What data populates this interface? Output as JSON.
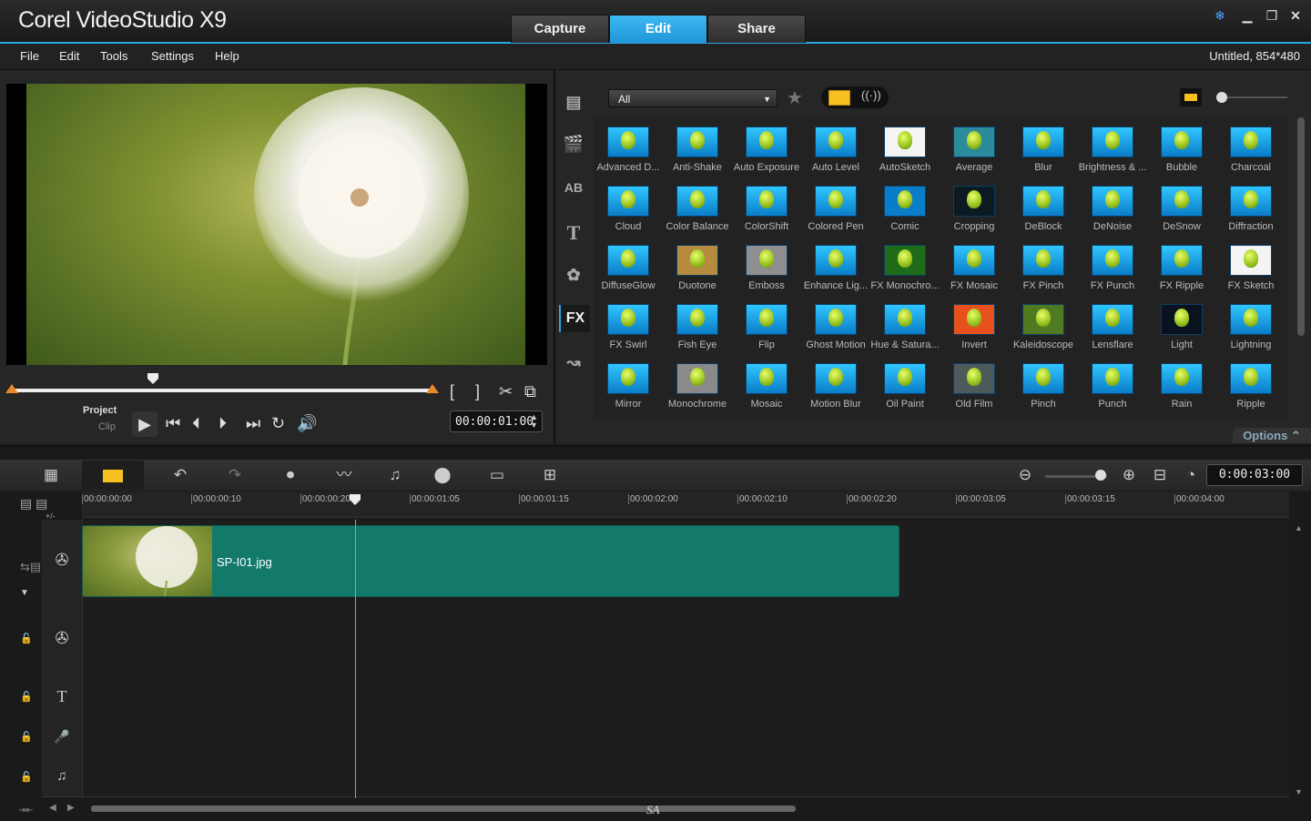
{
  "app": {
    "title": "Corel VideoStudio X9",
    "tabs": [
      "Capture",
      "Edit",
      "Share"
    ],
    "active_tab": "Edit",
    "project_info": "Untitled, 854*480"
  },
  "menu": [
    "File",
    "Edit",
    "Tools",
    "Settings",
    "Help"
  ],
  "preview": {
    "mode_project": "Project",
    "mode_clip": "Clip",
    "timecode": "00:00:01:00",
    "bracket_in": "[",
    "bracket_out": "]"
  },
  "library": {
    "filter": "All",
    "options_label": "Options",
    "active_category": "FX",
    "side_icons": [
      "media-icon",
      "instant-project-icon",
      "transition-icon",
      "title-icon",
      "graphic-icon",
      "fx-icon",
      "path-icon"
    ],
    "filters": [
      "Advanced D...",
      "Anti-Shake",
      "Auto Exposure",
      "Auto Level",
      "AutoSketch",
      "Average",
      "Blur",
      "Brightness & ...",
      "Bubble",
      "Charcoal",
      "Cloud",
      "Color Balance",
      "ColorShift",
      "Colored Pen",
      "Comic",
      "Cropping",
      "DeBlock",
      "DeNoise",
      "DeSnow",
      "Diffraction",
      "DiffuseGlow",
      "Duotone",
      "Emboss",
      "Enhance Lig...",
      "FX Monochro...",
      "FX Mosaic",
      "FX Pinch",
      "FX Punch",
      "FX Ripple",
      "FX Sketch",
      "FX Swirl",
      "Fish Eye",
      "Flip",
      "Ghost Motion",
      "Hue & Satura...",
      "Invert",
      "Kaleidoscope",
      "Lensflare",
      "Light",
      "Lightning",
      "Mirror",
      "Monochrome",
      "Mosaic",
      "Motion Blur",
      "Oil Paint",
      "Old Film",
      "Pinch",
      "Punch",
      "Rain",
      "Ripple"
    ]
  },
  "timeline": {
    "duration": "0:00:03:00",
    "ruler": [
      "00:00:00:00",
      "00:00:00:10",
      "00:00:00:20",
      "00:00:01:05",
      "00:00:01:15",
      "00:00:02:00",
      "00:00:02:10",
      "00:00:02:20",
      "00:00:03:05",
      "00:00:03:15",
      "00:00:04:00"
    ],
    "clip_name": "SP-I01.jpg",
    "track_add": "+/-",
    "watermark": "SA"
  },
  "colors": {
    "accent": "#2aa7e6",
    "clip": "#137a6b",
    "playhead": "#6aa8ff"
  }
}
